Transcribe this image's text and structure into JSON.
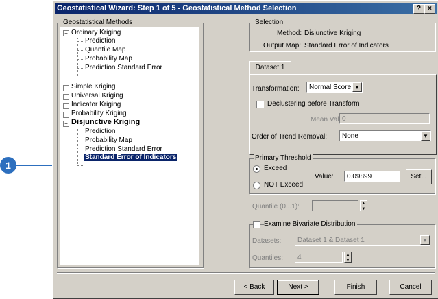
{
  "callout": {
    "number": "1",
    "color": "#2d6fbe"
  },
  "window": {
    "title": "Geostatistical Wizard: Step 1 of 5 - Geostatistical Method Selection",
    "help": "?",
    "close": "×"
  },
  "methods": {
    "label": "Geostatistical Methods",
    "ordinary": "Ordinary Kriging",
    "ordinary_children": [
      "Prediction",
      "Quantile Map",
      "Probability Map",
      "Prediction Standard Error"
    ],
    "simple": "Simple Kriging",
    "universal": "Universal Kriging",
    "indicator": "Indicator Kriging",
    "probability": "Probability Kriging",
    "disjunctive": "Disjunctive Kriging",
    "disjunctive_children": [
      "Prediction",
      "Probability Map",
      "Prediction Standard Error"
    ],
    "selected": "Standard Error of Indicators"
  },
  "selection": {
    "label": "Selection",
    "method_label": "Method:",
    "method_value": "Disjunctive Kriging",
    "output_label": "Output Map:",
    "output_value": "Standard Error of Indicators"
  },
  "dataset": {
    "tab": "Dataset 1",
    "transformation_label": "Transformation:",
    "transformation_value": "Normal Score",
    "declustering_label": "Declustering before Transform",
    "mean_label": "Mean Value:",
    "mean_value": "0",
    "trend_label": "Order of Trend Removal:",
    "trend_value": "None"
  },
  "threshold": {
    "label": "Primary Threshold",
    "exceed": "Exceed",
    "not_exceed": "NOT Exceed",
    "value_label": "Value:",
    "value": "0.09899",
    "set_button": "Set..."
  },
  "quantile": {
    "label": "Quantile (0...1):",
    "value": ""
  },
  "bivariate": {
    "label": "Examine Bivariate Distribution",
    "datasets_label": "Datasets:",
    "datasets_value": "Dataset 1 & Dataset 1",
    "quantiles_label": "Quantiles:",
    "quantiles_value": "4"
  },
  "buttons": {
    "back": "< Back",
    "next": "Next >",
    "finish": "Finish",
    "cancel": "Cancel"
  }
}
